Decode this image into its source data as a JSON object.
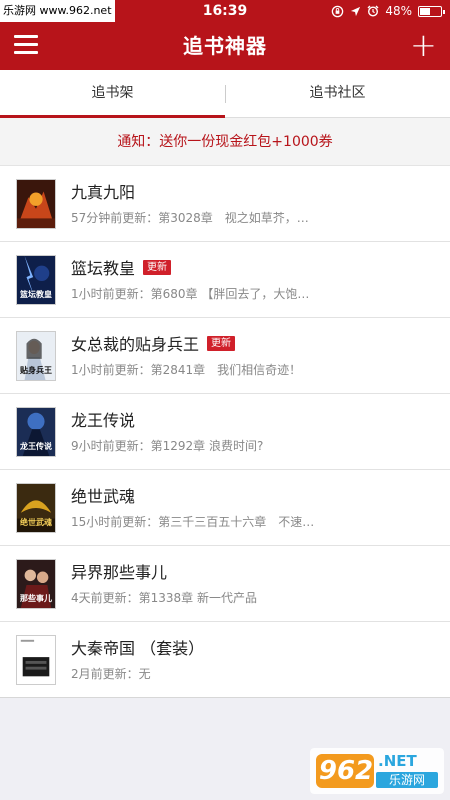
{
  "status_bar": {
    "carrier": "乐游网 www.962.net",
    "time": "16:39",
    "battery": "48%",
    "battery_level": 0.48
  },
  "nav": {
    "title": "追书神器"
  },
  "tabs": [
    {
      "label": "追书架",
      "active": true
    },
    {
      "label": "追书社区",
      "active": false
    }
  ],
  "notice": "通知：送你一份现金红包+1000券",
  "books": [
    {
      "title": "九真九阳",
      "badge": "",
      "update": "57分钟前更新：第3028章　视之如草芥，…",
      "cover_text": ""
    },
    {
      "title": "篮坛教皇",
      "badge": "更新",
      "update": "1小时前更新：第680章 【胖回去了，大饱…",
      "cover_text": "篮坛教皇"
    },
    {
      "title": "女总裁的贴身兵王",
      "badge": "更新",
      "update": "1小时前更新：第2841章　我们相信奇迹！",
      "cover_text": "贴身兵王"
    },
    {
      "title": "龙王传说",
      "badge": "",
      "update": "9小时前更新：第1292章 浪费时间?",
      "cover_text": "龙王传说"
    },
    {
      "title": "绝世武魂",
      "badge": "",
      "update": "15小时前更新：第三千三百五十六章　不速…",
      "cover_text": "绝世武魂"
    },
    {
      "title": "异界那些事儿",
      "badge": "",
      "update": "4天前更新：第1338章 新一代产品",
      "cover_text": "那些事儿"
    },
    {
      "title": "大秦帝国 （套装）",
      "badge": "",
      "update": "2月前更新：无",
      "cover_text": ""
    }
  ],
  "watermark": {
    "number": "962",
    "suffix": ".NET",
    "site": "乐游网"
  },
  "colors": {
    "brand_red": "#b7141a",
    "badge_red": "#d0202a"
  }
}
